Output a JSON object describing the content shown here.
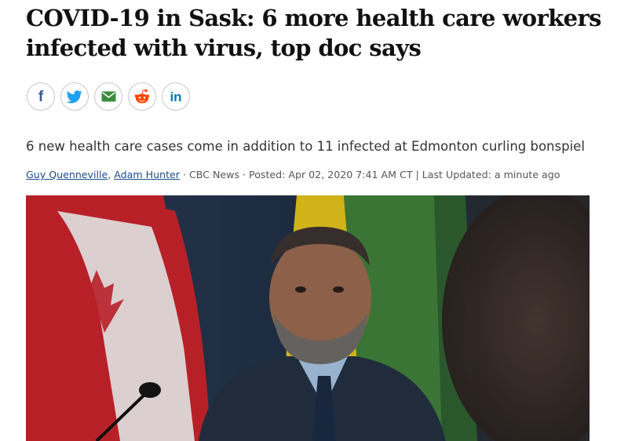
{
  "article": {
    "headline": "COVID-19 in Sask: 6 more health care workers infected with virus, top doc says",
    "deck": "6 new health care cases come in addition to 11 infected at Edmonton curling bonspiel",
    "byline": {
      "authors": [
        "Guy Quenneville",
        "Adam Hunter"
      ],
      "separator_comma": ",",
      "dot1": " · ",
      "source": "CBC News",
      "dot2": " · ",
      "posted": "Posted: Apr 02, 2020 7:41 AM CT",
      "pipe": " | ",
      "updated": "Last Updated: a minute ago"
    }
  },
  "share": {
    "facebook": "f",
    "twitter": "twitter-icon",
    "email": "email-icon",
    "reddit": "reddit-icon",
    "linkedin": "in"
  },
  "colors": {
    "facebook": "#3b5998",
    "twitter": "#1da1f2",
    "email": "#3a8c3f",
    "reddit": "#ff4500",
    "linkedin": "#0077b5",
    "link": "#1a4c8a"
  }
}
